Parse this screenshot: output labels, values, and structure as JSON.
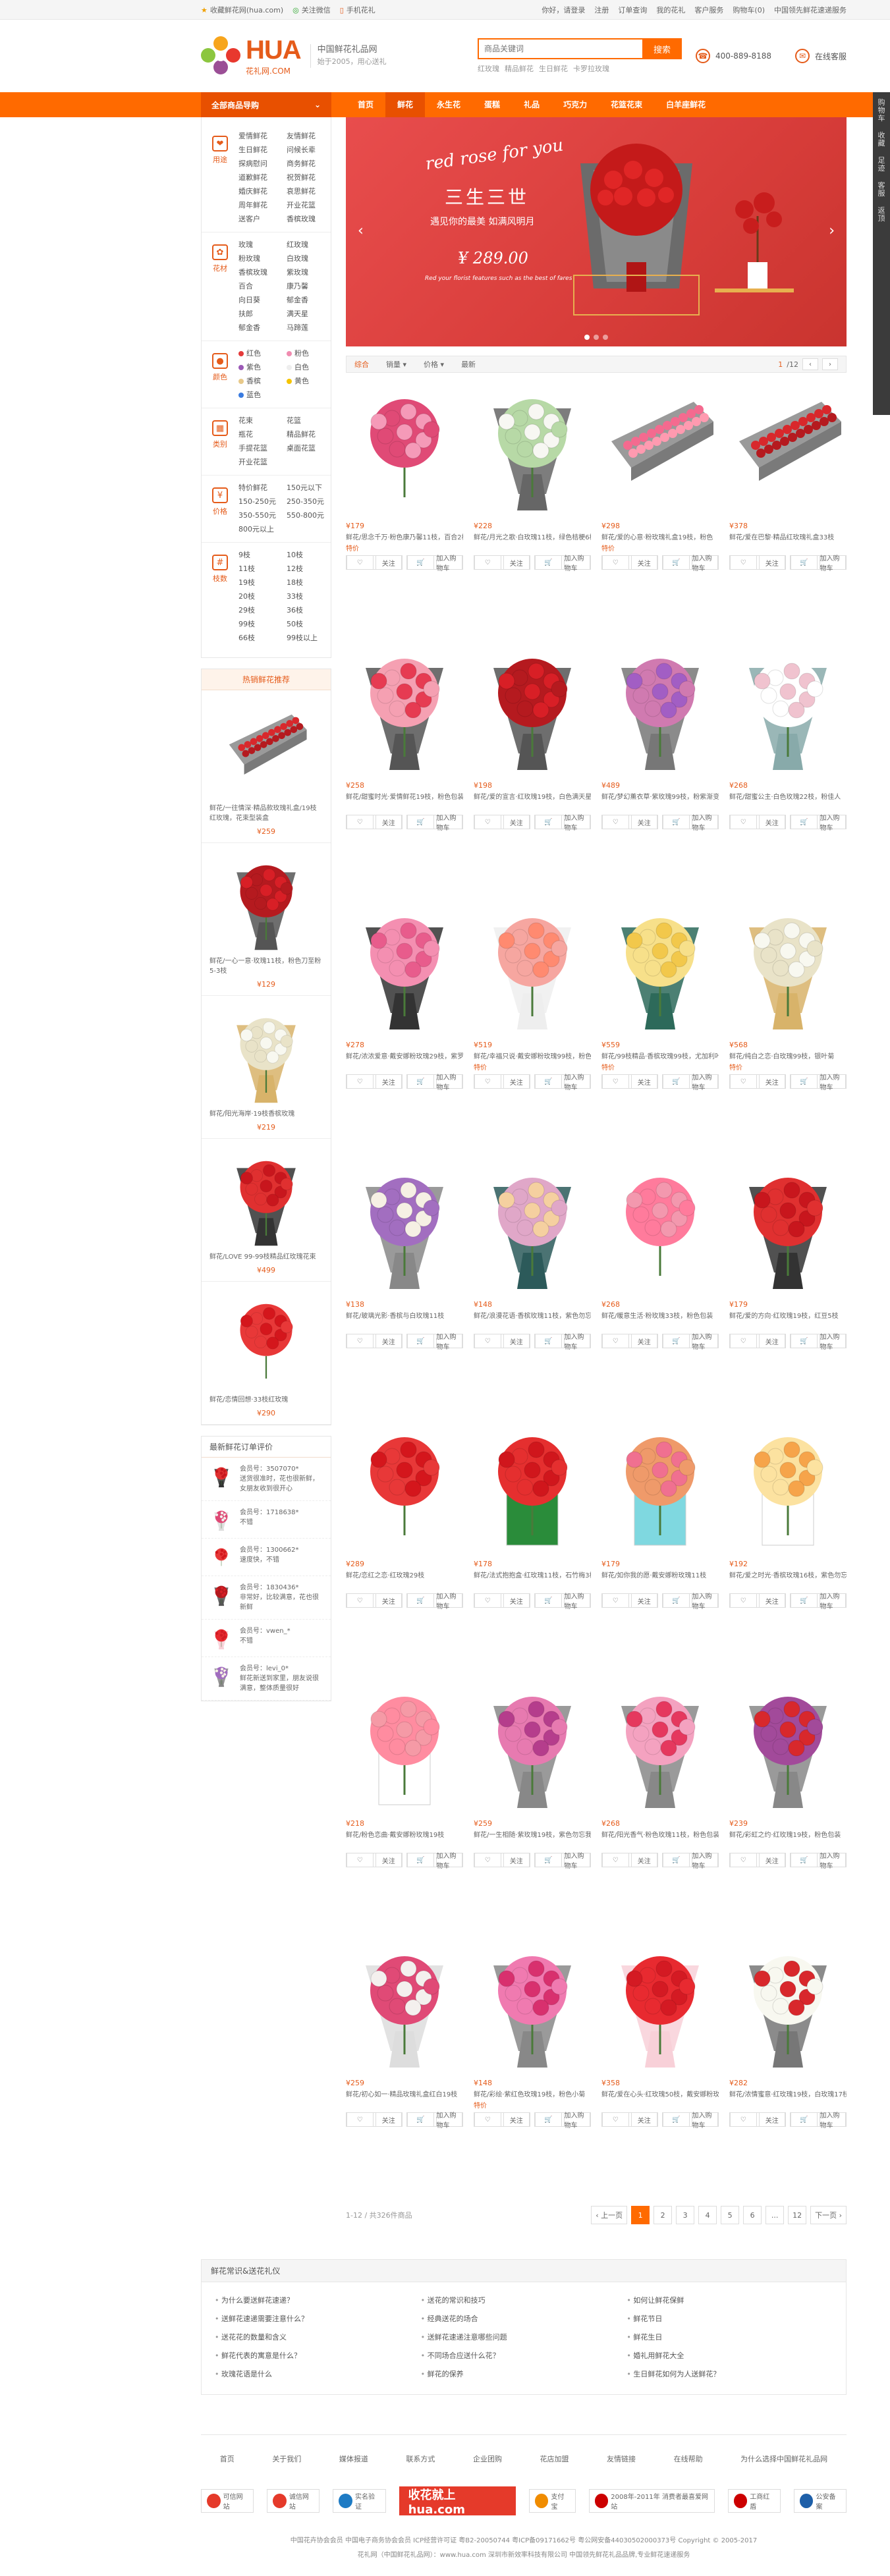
{
  "topbar": {
    "left": [
      "收藏鲜花网(hua.com)",
      "关注微信",
      "手机花礼"
    ],
    "right": [
      "你好，请登录",
      "注册",
      "订单查询",
      "我的花礼",
      "客户服务",
      "购物车(0)",
      "中国领先鲜花速递服务"
    ]
  },
  "header": {
    "brand": "HUA",
    "brand_sub": "花礼网.COM",
    "slogan1": "中国鲜花礼品网",
    "slogan2": "始于2005，用心送礼",
    "search_placeholder": "商品关键词",
    "search_button": "搜索",
    "hot": [
      "红玫瑰",
      "精品鲜花",
      "生日鲜花",
      "卡罗拉玫瑰"
    ],
    "phone": "400-889-8188",
    "service": "在线客服"
  },
  "nav": {
    "allcat": "全部商品导购",
    "links": [
      "首页",
      "鲜花",
      "永生花",
      "蛋糕",
      "礼品",
      "巧克力",
      "花篮花束",
      "白羊座鲜花"
    ]
  },
  "categories": [
    {
      "icon": "用途",
      "items": [
        "爱情鲜花",
        "友情鲜花",
        "生日鲜花",
        "问候长辈",
        "探病慰问",
        "商务鲜花",
        "道歉鲜花",
        "祝贺鲜花",
        "婚庆鲜花",
        "哀思鲜花",
        "周年鲜花",
        "开业花篮",
        "送客户",
        "香槟玫瑰"
      ]
    },
    {
      "icon": "花材",
      "items": [
        "玫瑰",
        "红玫瑰",
        "粉玫瑰",
        "白玫瑰",
        "香槟玫瑰",
        "紫玫瑰",
        "百合",
        "康乃馨",
        "向日葵",
        "郁金香",
        "扶郎",
        "满天星",
        "郁金香",
        "马蹄莲"
      ]
    },
    {
      "icon": "颜色",
      "items": [
        "红色",
        "粉色",
        "紫色",
        "白色",
        "香槟",
        "黄色",
        "蓝色"
      ]
    },
    {
      "icon": "类别",
      "items": [
        "花束",
        "花篮",
        "瓶花",
        "精品鲜花",
        "手提花篮",
        "桌面花篮",
        "开业花篮"
      ]
    },
    {
      "icon": "价格",
      "items": [
        "特价鲜花",
        "150元以下",
        "150-250元",
        "250-350元",
        "350-550元",
        "550-800元",
        "800元以上"
      ]
    },
    {
      "icon": "枝数",
      "items": [
        "9枝",
        "10枝",
        "11枝",
        "12枝",
        "19枝",
        "18枝",
        "20枝",
        "33枝",
        "29枝",
        "36枝",
        "99枝",
        "50枝",
        "66枝",
        "99枝以上"
      ]
    }
  ],
  "colors": {
    "红色": "#e43a3a",
    "粉色": "#f08cb0",
    "紫色": "#9b59b6",
    "白色": "#eeeeee",
    "香槟": "#e8c98a",
    "黄色": "#f5c400",
    "蓝色": "#3a7be0"
  },
  "hotbox": {
    "title": "热销鲜花推荐",
    "items": [
      {
        "name": "鲜花/一往情深·精品款玫瑰礼盒/19枝红玫瑰，花束型装盒",
        "price": "¥259"
      },
      {
        "name": "鲜花/一心一意·玫瑰11枝，粉色刀至粉5-3枝",
        "price": "¥129"
      },
      {
        "name": "鲜花/阳光海岸·19枝香槟玫瑰",
        "price": "¥219"
      },
      {
        "name": "鲜花/LOVE 99-99枝精品红玫瑰花束",
        "price": "¥499"
      },
      {
        "name": "鲜花/恋情回想·33枝红玫瑰",
        "price": "¥290"
      }
    ]
  },
  "reviews": {
    "title": "最新鲜花订单评价",
    "items": [
      {
        "user": "会员号：3507070*",
        "text": "送货很准时，花也很新鲜，女朋友收到很开心"
      },
      {
        "user": "会员号：1718638*",
        "text": "不错"
      },
      {
        "user": "会员号：1300662*",
        "text": "速度快，不错"
      },
      {
        "user": "会员号：1830436*",
        "text": "非常好，比较满意，花也很新鲜"
      },
      {
        "user": "会员号：vwen_*",
        "text": "不错"
      },
      {
        "user": "会员号：levi_0*",
        "text": "鲜花新送到家里，朋友说很满意，整体质量很好"
      }
    ]
  },
  "banner": {
    "script": "red rose for you",
    "title": "三生三世",
    "sub": "遇见你的最美  如满风明月",
    "price": "¥ 289.00",
    "note": "Red your florist features such as the best of fares"
  },
  "sortbar": {
    "items": [
      "综合",
      "销量",
      "价格",
      "最新"
    ],
    "page": "1",
    "total": "/12"
  },
  "products": [
    {
      "price": "¥179",
      "name": "鲜花/思念千万·粉色康乃馨11枝，百合2枝",
      "tag": "特价"
    },
    {
      "price": "¥228",
      "name": "鲜花/月光之歌·白玫瑰11枝，绿色桔梗6枝",
      "tag": ""
    },
    {
      "price": "¥298",
      "name": "鲜花/爱的心意·粉玫瑰礼盒19枝，粉色",
      "tag": "特价"
    },
    {
      "price": "¥378",
      "name": "鲜花/爱在巴黎·精品红玫瑰礼盒33枝",
      "tag": ""
    },
    {
      "price": "¥258",
      "name": "鲜花/甜蜜时光·爱情鲜花19枝，粉色包装",
      "tag": ""
    },
    {
      "price": "¥198",
      "name": "鲜花/爱的宣言·红玫瑰19枝，白色满天星",
      "tag": ""
    },
    {
      "price": "¥489",
      "name": "鲜花/梦幻薰衣草·紫玫瑰99枝，粉紫渐变",
      "tag": ""
    },
    {
      "price": "¥268",
      "name": "鲜花/甜蜜公主·白色玫瑰22枝，粉佳人",
      "tag": ""
    },
    {
      "price": "¥278",
      "name": "鲜花/浓浓爱意·戴安娜粉玫瑰29枝，紫罗兰",
      "tag": ""
    },
    {
      "price": "¥519",
      "name": "鲜花/幸福只说·戴安娜粉玫瑰99枝，粉色",
      "tag": "特价"
    },
    {
      "price": "¥559",
      "name": "鲜花/99枝精品·香槟玫瑰99枝，尤加利叶",
      "tag": "特价"
    },
    {
      "price": "¥568",
      "name": "鲜花/纯白之恋·白玫瑰99枝，银叶菊",
      "tag": "特价"
    },
    {
      "price": "¥138",
      "name": "鲜花/玻璃光影·香槟与白玫瑰11枝",
      "tag": ""
    },
    {
      "price": "¥148",
      "name": "鲜花/浪漫花语·香槟玫瑰11枝，紫色勿忘我",
      "tag": ""
    },
    {
      "price": "¥268",
      "name": "鲜花/暖意生活·粉玫瑰33枝，粉色包装",
      "tag": ""
    },
    {
      "price": "¥179",
      "name": "鲜花/爱的方向·红玫瑰19枝，红豆5枝",
      "tag": ""
    },
    {
      "price": "¥289",
      "name": "鲜花/恋红之恋·红玫瑰29枝",
      "tag": ""
    },
    {
      "price": "¥178",
      "name": "鲜花/法式抱抱盒·红玫瑰11枝，石竹梅3枝",
      "tag": ""
    },
    {
      "price": "¥179",
      "name": "鲜花/如你我的愿·戴安娜粉玫瑰11枝",
      "tag": ""
    },
    {
      "price": "¥192",
      "name": "鲜花/爱之时光·香槟玫瑰16枝，紫色勿忘我",
      "tag": ""
    },
    {
      "price": "¥218",
      "name": "鲜花/粉色恋曲·戴安娜粉玫瑰19枝",
      "tag": ""
    },
    {
      "price": "¥259",
      "name": "鲜花/一生相随·紫玫瑰19枝，紫色勿忘我",
      "tag": ""
    },
    {
      "price": "¥268",
      "name": "鲜花/阳光香气·粉色玫瑰11枝，粉色包装",
      "tag": ""
    },
    {
      "price": "¥239",
      "name": "鲜花/彩虹之约·红玫瑰19枝，粉色包装",
      "tag": ""
    },
    {
      "price": "¥259",
      "name": "鲜花/初心如一·精品玫瑰礼盒红白19枝",
      "tag": ""
    },
    {
      "price": "¥148",
      "name": "鲜花/彩绘·紫红色玫瑰19枝，粉色小菊",
      "tag": "特价"
    },
    {
      "price": "¥358",
      "name": "鲜花/爱在心头·红玫瑰50枝，戴安娜粉玫瑰",
      "tag": ""
    },
    {
      "price": "¥282",
      "name": "鲜花/浓情蜜意·红玫瑰19枝，白玫瑰17枝",
      "tag": ""
    }
  ],
  "card_actions": {
    "fav": "关注",
    "cart": "加入购物车"
  },
  "pager": {
    "summary": "1-12 / 共326件商品",
    "prev": "上一页",
    "pages": [
      "1",
      "2",
      "3",
      "4",
      "5",
      "6",
      "...",
      "12"
    ],
    "next": "下一页"
  },
  "knowledge": {
    "title": "鲜花常识&送花礼仪",
    "cols": [
      [
        "为什么要送鲜花速递？",
        "送鲜花速递需要注意什么？",
        "送花花的数量和含义",
        "鲜花代表的寓意是什么？",
        "玫瑰花语是什么"
      ],
      [
        "送花的常识和技巧",
        "经典送花的场合",
        "送鲜花速递注意哪些问题",
        "不同场合应送什么花？",
        "鲜花的保养"
      ],
      [
        "如何让鲜花保鲜",
        "鲜花节日",
        "鲜花生日",
        "婚礼用鲜花大全",
        "生日鲜花如何为人送鲜花？"
      ]
    ]
  },
  "footer": {
    "nav": [
      "首页",
      "关于我们",
      "媒体报道",
      "联系方式",
      "企业团购",
      "花店加盟",
      "友情链接",
      "在线帮助",
      "为什么选择中国鲜花礼品网"
    ],
    "badges": [
      "可信网站",
      "诚信网站",
      "实名验证",
      "收花就上hua.com",
      "支付宝",
      "2008年-2011年 消费者最喜爱网站",
      "工商红盾",
      "公安备案"
    ],
    "copy1": "中国花卉协会会员 中国电子商务协会会员 ICP经营许可证 粤B2-20050744  粤ICP备09171662号  粤公网安备44030502000373号 Copyright © 2005-2017",
    "copy2": "花礼网（中国鲜花礼品网）：www.hua.com 深圳市新效率科技有限公司 中国领先鲜花礼品品牌,专业鲜花速递服务"
  },
  "rail": [
    "购物车",
    "收藏",
    "足迹",
    "客服",
    "返顶"
  ]
}
